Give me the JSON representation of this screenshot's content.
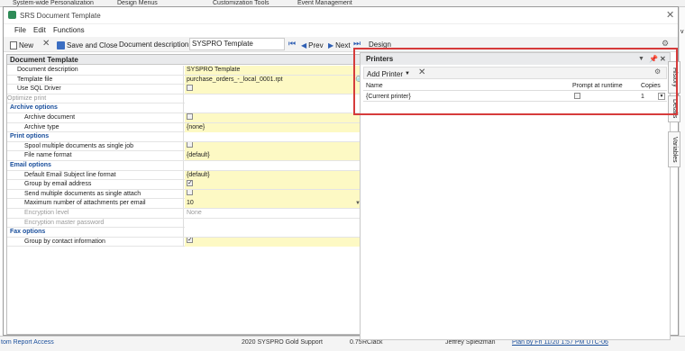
{
  "background": {
    "tabs": [
      "System-wide Personalization",
      "Design Menus",
      "Customization Tools",
      "Event Management"
    ],
    "right_edge_text": "v",
    "bottom": {
      "c1": "tom Report Access",
      "c2": "2020 SYSPRO Gold Support",
      "c3": "0.75",
      "c4": "RClack",
      "c5": "Jeffrey Spielzman",
      "c6": "Plan by Fri 11/20 1:57 PM UTC-06"
    }
  },
  "window": {
    "title": "SRS Document Template",
    "menu": [
      "File",
      "Edit",
      "Functions"
    ],
    "toolbar": {
      "new_label": "New",
      "save_close_label": "Save and Close",
      "desc_label": "Document description:",
      "desc_value": "SYSPRO Template",
      "prev_label": "Prev",
      "next_label": "Next",
      "design_label": "Design"
    }
  },
  "doc_template": {
    "header": "Document Template",
    "rows": [
      {
        "label": "Document description",
        "value": "SYSPRO Template",
        "kind": "prop"
      },
      {
        "label": "Template file",
        "value": "purchase_orders_-_local_0001.rpt",
        "kind": "prop"
      },
      {
        "label": "Use SQL Driver",
        "value": "",
        "kind": "prop",
        "checkbox": "off"
      },
      {
        "label": "Optimize print",
        "value": "",
        "kind": "dis",
        "checkbox": "none"
      },
      {
        "label": "Archive options",
        "value": "",
        "kind": "grp"
      },
      {
        "label": "Archive document",
        "value": "",
        "kind": "sub",
        "checkbox": "off"
      },
      {
        "label": "Archive type",
        "value": "{none}",
        "kind": "sub"
      },
      {
        "label": "Print options",
        "value": "",
        "kind": "grp"
      },
      {
        "label": "Spool multiple documents as single job",
        "value": "",
        "kind": "sub",
        "checkbox": "off"
      },
      {
        "label": "File name format",
        "value": "{default}",
        "kind": "sub"
      },
      {
        "label": "Email options",
        "value": "",
        "kind": "grp"
      },
      {
        "label": "Default Email Subject line format",
        "value": "{default}",
        "kind": "sub"
      },
      {
        "label": "Group by email address",
        "value": "",
        "kind": "sub",
        "checkbox": "on"
      },
      {
        "label": "Send multiple documents as single attach",
        "value": "",
        "kind": "sub",
        "checkbox": "off"
      },
      {
        "label": "Maximum number of attachments per email",
        "value": "10",
        "kind": "sub",
        "dropdown": true
      },
      {
        "label": "Encryption level",
        "value": "None",
        "kind": "sub dis"
      },
      {
        "label": "Encryption master password",
        "value": "",
        "kind": "sub dis"
      },
      {
        "label": "Fax options",
        "value": "",
        "kind": "grp"
      },
      {
        "label": "Group by contact information",
        "value": "",
        "kind": "sub",
        "checkbox": "on"
      }
    ]
  },
  "printers": {
    "title": "Printers",
    "add_label": "Add Printer",
    "columns": [
      "Name",
      "Prompt at runtime",
      "Copies"
    ],
    "row": {
      "name": "{Current printer}",
      "copies": "1"
    }
  },
  "side_tabs": [
    "History",
    "Details",
    "Variables"
  ],
  "colors": {
    "accent": "#1a4f9c",
    "highlight": "#d63b3b",
    "value_bg": "#fdf9c4"
  }
}
